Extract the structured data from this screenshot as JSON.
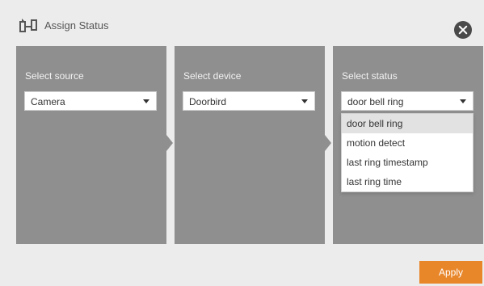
{
  "dialog": {
    "title": "Assign Status",
    "close_icon": "close-icon"
  },
  "panels": [
    {
      "label": "Select source",
      "selected_value": "Camera"
    },
    {
      "label": "Select device",
      "selected_value": "Doorbird"
    },
    {
      "label": "Select status",
      "selected_value": "door bell ring"
    }
  ],
  "status_dropdown": {
    "options": [
      "door bell ring",
      "motion detect",
      "last ring timestamp",
      "last ring time"
    ],
    "highlighted_index": 0
  },
  "footer": {
    "apply_label": "Apply"
  },
  "colors": {
    "accent": "#e8862a",
    "panel": "#8f8f8f",
    "background": "#ececec"
  }
}
